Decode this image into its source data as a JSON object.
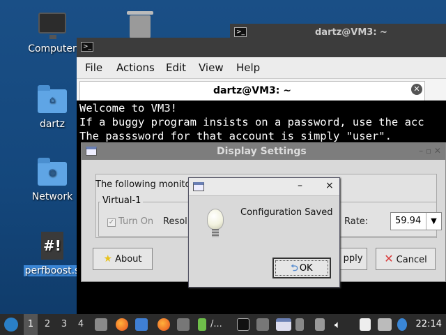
{
  "desktop": {
    "icons": [
      {
        "label": "Computer"
      },
      {
        "label": "dartz"
      },
      {
        "label": "Network"
      },
      {
        "label": "perfboost.sh",
        "shown": "perfboost.s"
      }
    ],
    "trash_icon": "trash-icon"
  },
  "bg_terminal": {
    "title": "dartz@VM3: ~"
  },
  "terminal": {
    "menu": [
      "File",
      "Actions",
      "Edit",
      "View",
      "Help"
    ],
    "tab_title": "dartz@VM3: ~",
    "lines": [
      "Welcome to VM3!",
      "If a buggy program insists on a password, use the acc",
      "The passsword for that account is simply \"user\"."
    ]
  },
  "display_settings": {
    "title": "Display Settings",
    "intro": "The following monito",
    "monitor_name": "Virtual-1",
    "turn_on_label": "Turn On",
    "resolution_label": "Resol",
    "rate_label": "Rate:",
    "rate_value": "59.94",
    "about_label": "About",
    "apply_label": "pply",
    "cancel_label": "Cancel"
  },
  "dialog": {
    "message": "Configuration Saved",
    "ok_label": "OK",
    "minimize": "–",
    "close": "×"
  },
  "taskbar": {
    "workspaces": [
      "1",
      "2",
      "3",
      "4"
    ],
    "active_workspace": "1",
    "folder_task": "/...",
    "clock": "22:14"
  }
}
